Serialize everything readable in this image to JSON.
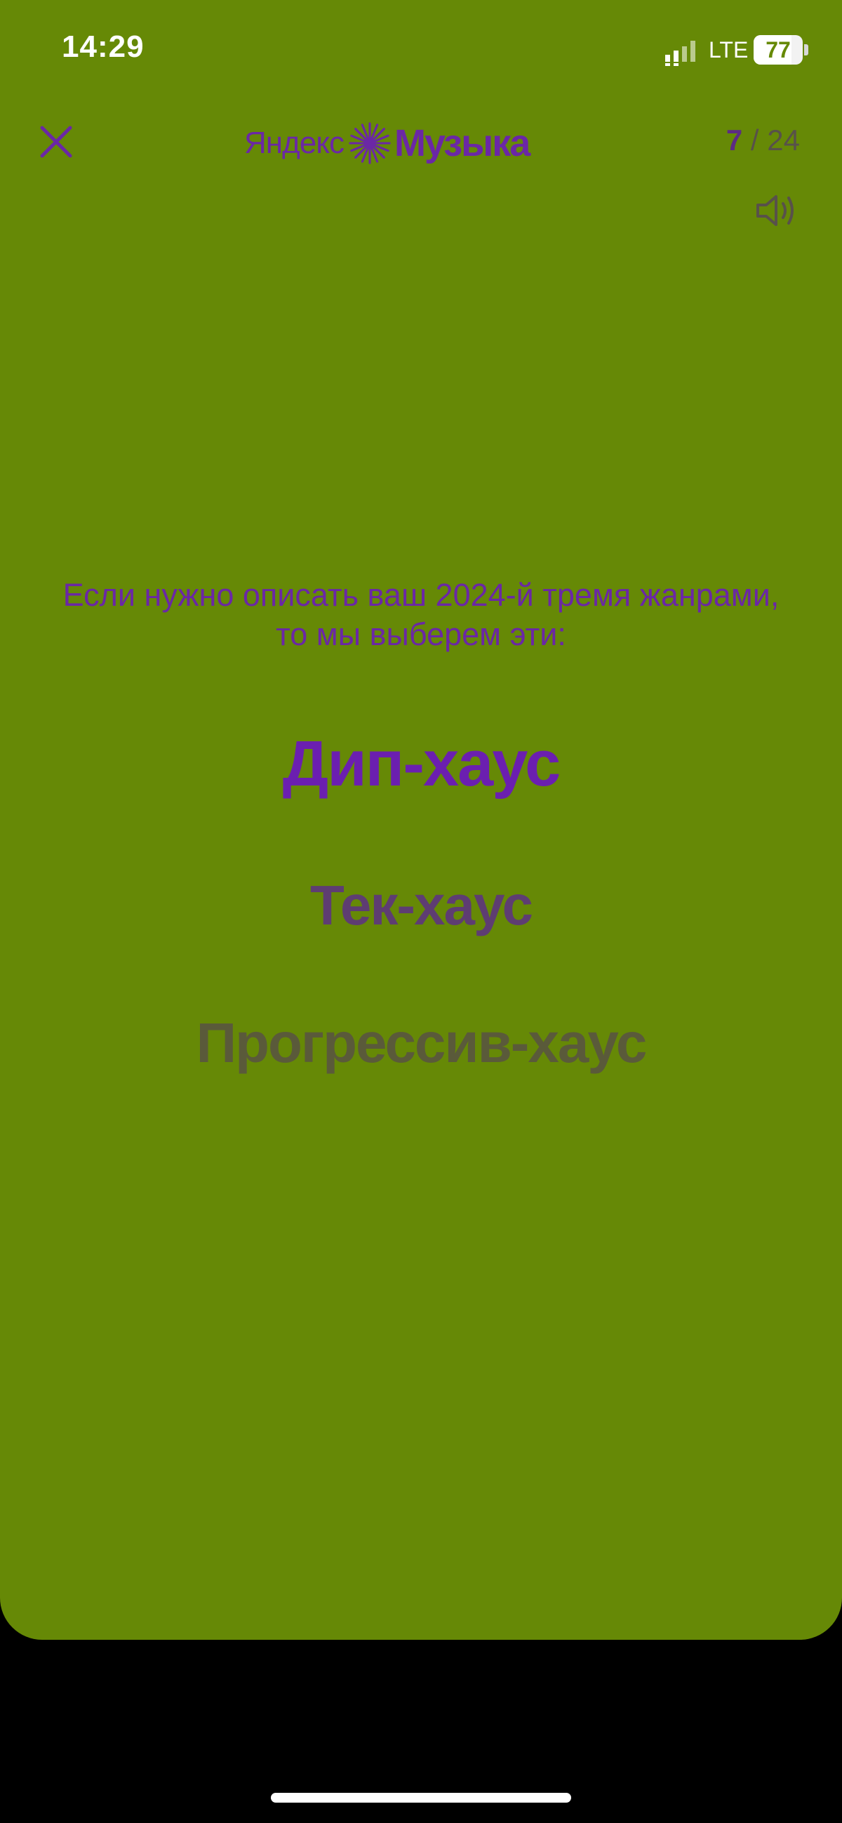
{
  "status_bar": {
    "time": "14:29",
    "network": "LTE",
    "battery": "77",
    "battery_level": 0.77,
    "signal_icon": "signal-bars-icon"
  },
  "header": {
    "close_icon": "close-icon",
    "logo_yandex": "Яндекс",
    "logo_music": "Музыка",
    "logo_icon": "yandex-music-star-icon",
    "page_current": "7",
    "page_separator": " / ",
    "page_total": "24",
    "sound_icon": "speaker-icon"
  },
  "content": {
    "intro_line1": "Если нужно описать ваш 2024-й тремя жанрами,",
    "intro_line2": "то мы выберем эти:",
    "genres": [
      "Дип-хаус",
      "Тек-хаус",
      "Прогрессив-хаус"
    ]
  },
  "colors": {
    "background": "#668906",
    "accent_purple": "#6b27a6"
  }
}
